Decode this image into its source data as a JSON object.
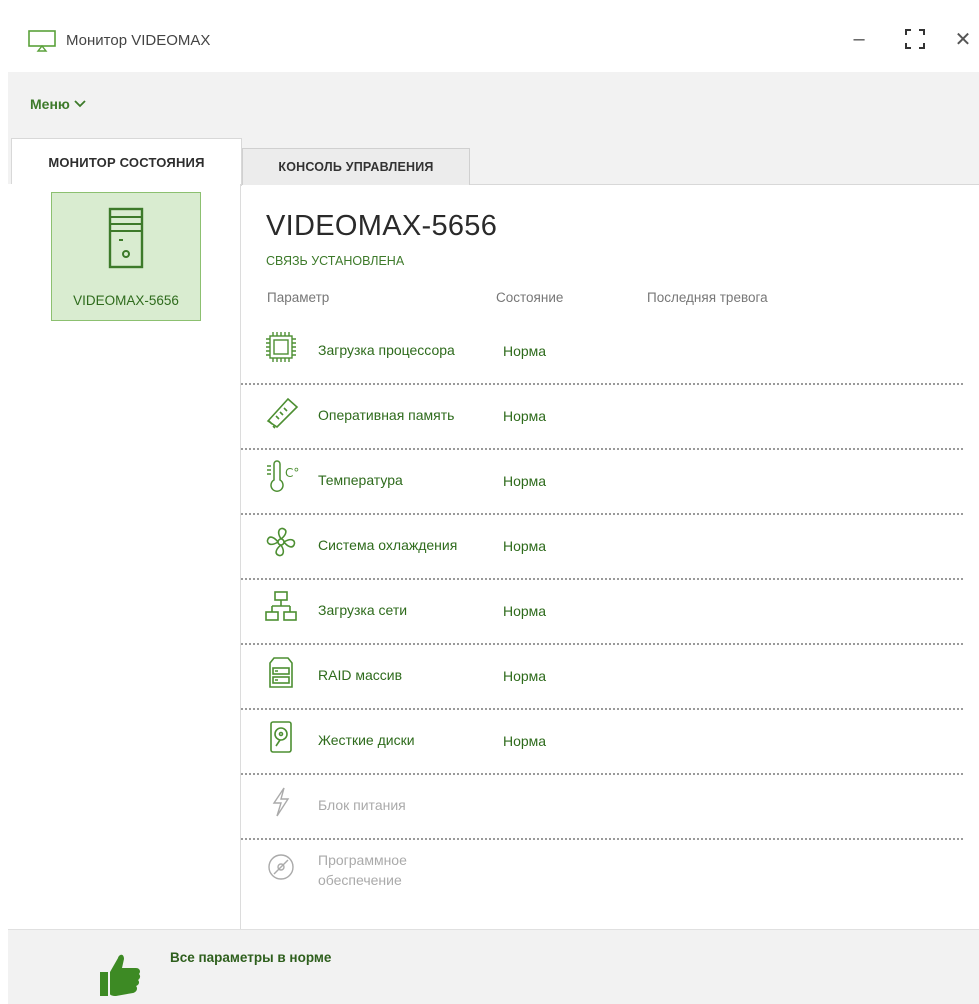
{
  "window": {
    "title": "Монитор VIDEOMAX",
    "minimize_symbol": "–",
    "close_symbol": "✕"
  },
  "menu": {
    "label": "Меню"
  },
  "tabs": [
    {
      "label": "МОНИТОР СОСТОЯНИЯ",
      "active": true
    },
    {
      "label": "КОНСОЛЬ УПРАВЛЕНИЯ",
      "active": false
    }
  ],
  "sidebar": {
    "devices": [
      {
        "name": "VIDEOMAX-5656",
        "selected": true
      }
    ]
  },
  "main": {
    "host_name": "VIDEOMAX-5656",
    "connection_status": "СВЯЗЬ УСТАНОВЛЕНА",
    "columns": {
      "param": "Параметр",
      "state": "Состояние",
      "alarm": "Последняя тревога"
    },
    "rows": [
      {
        "icon": "cpu-icon",
        "label": "Загрузка процессора",
        "state": "Норма",
        "enabled": true
      },
      {
        "icon": "ram-icon",
        "label": "Оперативная память",
        "state": "Норма",
        "enabled": true
      },
      {
        "icon": "thermometer-icon",
        "label": "Температура",
        "state": "Норма",
        "enabled": true
      },
      {
        "icon": "fan-icon",
        "label": "Система охлаждения",
        "state": "Норма",
        "enabled": true
      },
      {
        "icon": "network-icon",
        "label": "Загрузка сети",
        "state": "Норма",
        "enabled": true
      },
      {
        "icon": "raid-icon",
        "label": "RAID массив",
        "state": "Норма",
        "enabled": true
      },
      {
        "icon": "hdd-icon",
        "label": "Жесткие диски",
        "state": "Норма",
        "enabled": true
      },
      {
        "icon": "power-icon",
        "label": "Блок питания",
        "state": "",
        "enabled": false
      },
      {
        "icon": "software-disc-icon",
        "label": "Программное обеспечение",
        "state": "",
        "enabled": false
      }
    ]
  },
  "footer": {
    "message": "Все параметры в норме"
  },
  "colors": {
    "accent": "#3d7a2a",
    "accent_light": "#d9ecd0",
    "disabled": "#aaaaaa"
  }
}
